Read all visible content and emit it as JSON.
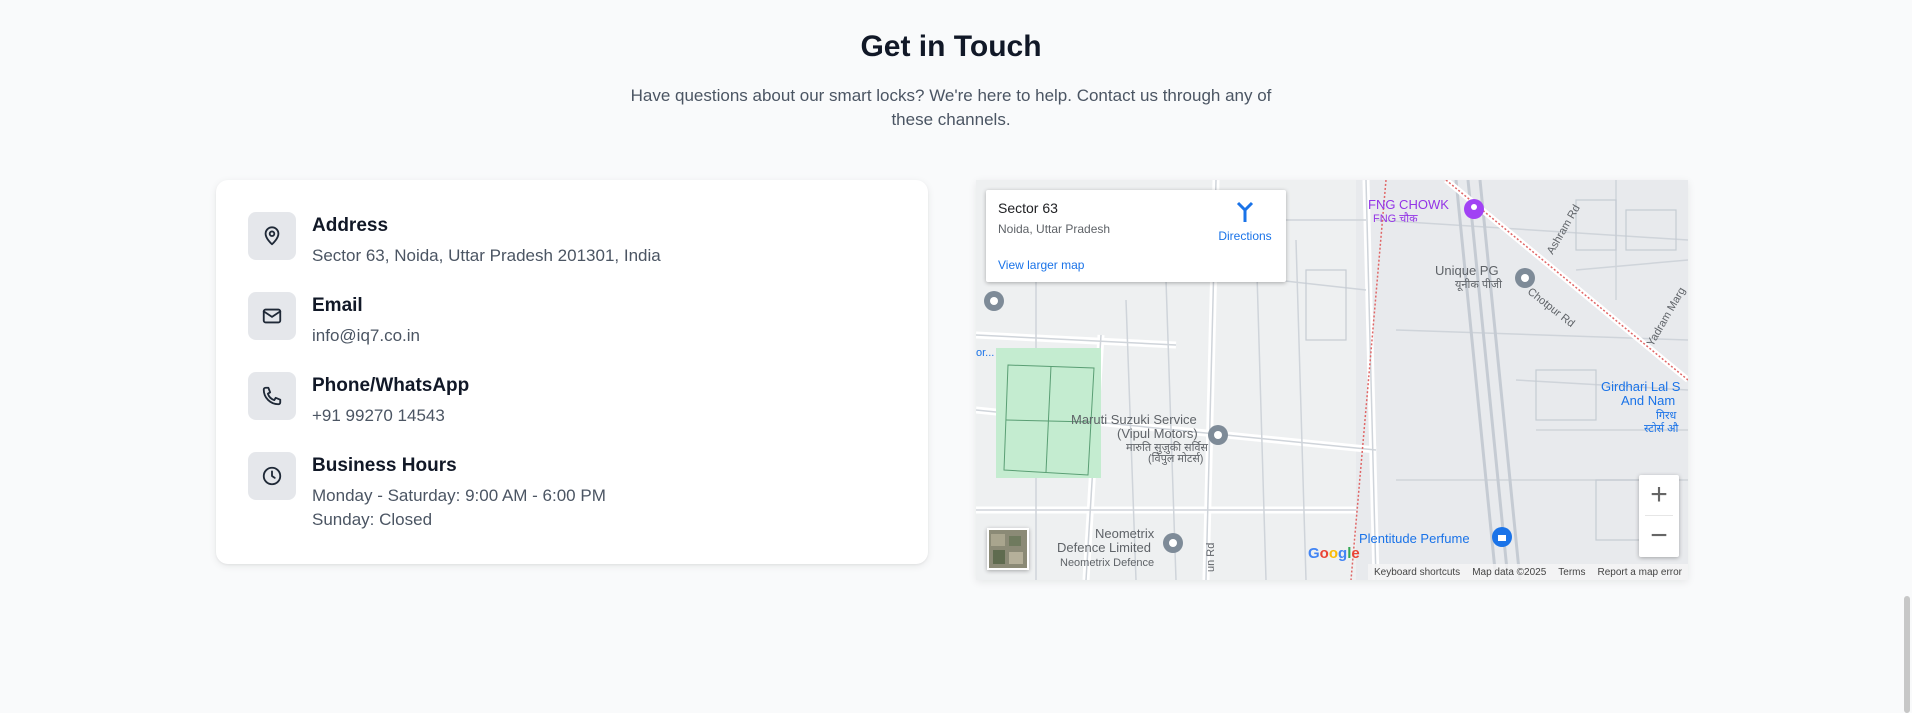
{
  "header": {
    "title": "Get in Touch",
    "subtitle": "Have questions about our smart locks? We're here to help. Contact us through any of these channels."
  },
  "contact": {
    "items": [
      {
        "icon": "map-pin-icon",
        "title": "Address",
        "value": "Sector 63, Noida, Uttar Pradesh 201301, India"
      },
      {
        "icon": "mail-icon",
        "title": "Email",
        "value": "info@iq7.co.in"
      },
      {
        "icon": "phone-icon",
        "title": "Phone/WhatsApp",
        "value": "+91 99270 14543"
      },
      {
        "icon": "clock-icon",
        "title": "Business Hours",
        "value": "Monday - Saturday: 9:00 AM - 6:00 PM",
        "value2": "Sunday: Closed"
      }
    ]
  },
  "map": {
    "place_title": "Sector 63",
    "place_sub": "Noida, Uttar Pradesh",
    "directions_label": "Directions",
    "view_larger": "View larger map",
    "zoom_in": "+",
    "zoom_out": "−",
    "google_logo": "Google",
    "labels": {
      "fng_chowk": "FNG CHOWK",
      "fng_chowk_hi": "FNG चौक",
      "unique_pg": "Unique PG",
      "unique_pg_hi": "यूनीक पीजी",
      "chotpur_rd": "Chotpur Rd",
      "ashram_rd": "Ashram Rd",
      "yadram_marg": "Yadram Marg",
      "girdhari_1": "Girdhari Lal S",
      "girdhari_2": "And Nam",
      "girdhari_hi_1": "गिरध",
      "girdhari_hi_2": "स्टोर्स औ",
      "maruti_1": "Maruti Suzuki Service",
      "maruti_2": "(Vipul Motors)",
      "maruti_hi_1": "मारुति सुज़ुकी सर्विस",
      "maruti_hi_2": "(विपुल मोटर्स)",
      "neometrix_1": "Neometrix",
      "neometrix_2": "Defence Limited",
      "neometrix_hi": "Neometrix Defence",
      "plentitude": "Plentitude Perfume",
      "left_cut": "or...",
      "un_rd": "un Rd"
    },
    "attribution": [
      "Keyboard shortcuts",
      "Map data ©2025",
      "Terms",
      "Report a map error"
    ]
  },
  "colors": {
    "background": "#f9fafb",
    "card": "#ffffff",
    "icon_box": "#e5e7eb",
    "text_primary": "#111827",
    "text_secondary": "#4b5563",
    "map_link": "#1a73e8",
    "map_park": "#c4ecd0"
  }
}
